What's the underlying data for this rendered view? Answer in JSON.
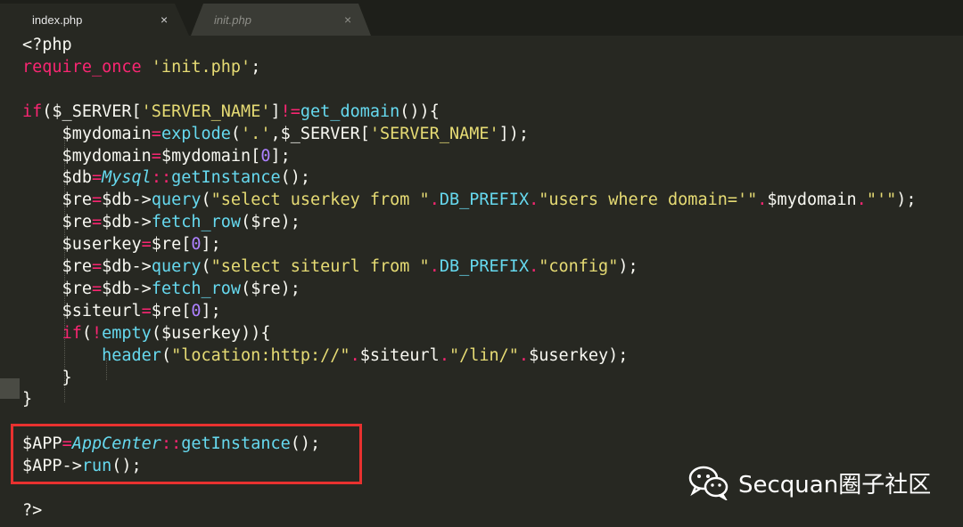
{
  "tabs": [
    {
      "label": "index.php",
      "active": true,
      "close": "×"
    },
    {
      "label": "init.php",
      "active": false,
      "close": "×"
    }
  ],
  "code": {
    "lines": [
      [
        [
          "pl",
          "<?php"
        ]
      ],
      [
        [
          "kw",
          "require_once"
        ],
        [
          "pl",
          " "
        ],
        [
          "str",
          "'init.php'"
        ],
        [
          "pl",
          ";"
        ]
      ],
      [],
      [
        [
          "kw",
          "if"
        ],
        [
          "pl",
          "($_SERVER["
        ],
        [
          "str",
          "'SERVER_NAME'"
        ],
        [
          "pl",
          "]"
        ],
        [
          "kw",
          "!="
        ],
        [
          "fn",
          "get_domain"
        ],
        [
          "pl",
          "()){"
        ]
      ],
      [
        [
          "pl",
          "    $mydomain"
        ],
        [
          "kw",
          "="
        ],
        [
          "fn",
          "explode"
        ],
        [
          "pl",
          "("
        ],
        [
          "str",
          "'.'"
        ],
        [
          "pl",
          ",$_SERVER["
        ],
        [
          "str",
          "'SERVER_NAME'"
        ],
        [
          "pl",
          "]);"
        ]
      ],
      [
        [
          "pl",
          "    $mydomain"
        ],
        [
          "kw",
          "="
        ],
        [
          "pl",
          "$mydomain["
        ],
        [
          "num",
          "0"
        ],
        [
          "pl",
          "];"
        ]
      ],
      [
        [
          "pl",
          "    $db"
        ],
        [
          "kw",
          "="
        ],
        [
          "cls",
          "Mysql"
        ],
        [
          "kw",
          "::"
        ],
        [
          "fn",
          "getInstance"
        ],
        [
          "pl",
          "();"
        ]
      ],
      [
        [
          "pl",
          "    $re"
        ],
        [
          "kw",
          "="
        ],
        [
          "pl",
          "$db->"
        ],
        [
          "fn",
          "query"
        ],
        [
          "pl",
          "("
        ],
        [
          "str",
          "\"select userkey from \""
        ],
        [
          "kw",
          "."
        ],
        [
          "fn",
          "DB_PREFIX"
        ],
        [
          "kw",
          "."
        ],
        [
          "str",
          "\"users where domain='\""
        ],
        [
          "kw",
          "."
        ],
        [
          "pl",
          "$mydomain"
        ],
        [
          "kw",
          "."
        ],
        [
          "str",
          "\"'\""
        ],
        [
          "pl",
          ");"
        ]
      ],
      [
        [
          "pl",
          "    $re"
        ],
        [
          "kw",
          "="
        ],
        [
          "pl",
          "$db->"
        ],
        [
          "fn",
          "fetch_row"
        ],
        [
          "pl",
          "($re);"
        ]
      ],
      [
        [
          "pl",
          "    $userkey"
        ],
        [
          "kw",
          "="
        ],
        [
          "pl",
          "$re["
        ],
        [
          "num",
          "0"
        ],
        [
          "pl",
          "];"
        ]
      ],
      [
        [
          "pl",
          "    $re"
        ],
        [
          "kw",
          "="
        ],
        [
          "pl",
          "$db->"
        ],
        [
          "fn",
          "query"
        ],
        [
          "pl",
          "("
        ],
        [
          "str",
          "\"select siteurl from \""
        ],
        [
          "kw",
          "."
        ],
        [
          "fn",
          "DB_PREFIX"
        ],
        [
          "kw",
          "."
        ],
        [
          "str",
          "\"config\""
        ],
        [
          "pl",
          ");"
        ]
      ],
      [
        [
          "pl",
          "    $re"
        ],
        [
          "kw",
          "="
        ],
        [
          "pl",
          "$db->"
        ],
        [
          "fn",
          "fetch_row"
        ],
        [
          "pl",
          "($re);"
        ]
      ],
      [
        [
          "pl",
          "    $siteurl"
        ],
        [
          "kw",
          "="
        ],
        [
          "pl",
          "$re["
        ],
        [
          "num",
          "0"
        ],
        [
          "pl",
          "];"
        ]
      ],
      [
        [
          "pl",
          "    "
        ],
        [
          "kw",
          "if"
        ],
        [
          "pl",
          "("
        ],
        [
          "kw",
          "!"
        ],
        [
          "fn",
          "empty"
        ],
        [
          "pl",
          "($userkey)){"
        ]
      ],
      [
        [
          "pl",
          "        "
        ],
        [
          "fn",
          "header"
        ],
        [
          "pl",
          "("
        ],
        [
          "str",
          "\"location:http://\""
        ],
        [
          "kw",
          "."
        ],
        [
          "pl",
          "$siteurl"
        ],
        [
          "kw",
          "."
        ],
        [
          "str",
          "\"/lin/\""
        ],
        [
          "kw",
          "."
        ],
        [
          "pl",
          "$userkey"
        ],
        [
          "pl",
          ");"
        ]
      ],
      [
        [
          "pl",
          "    }"
        ]
      ],
      [
        [
          "pl",
          "}"
        ]
      ],
      [],
      [
        [
          "pl",
          "$APP"
        ],
        [
          "kw",
          "="
        ],
        [
          "cls",
          "AppCenter"
        ],
        [
          "kw",
          "::"
        ],
        [
          "fn",
          "getInstance"
        ],
        [
          "pl",
          "();"
        ]
      ],
      [
        [
          "pl",
          "$APP->"
        ],
        [
          "fn",
          "run"
        ],
        [
          "pl",
          "();"
        ]
      ],
      [],
      [
        [
          "pl",
          "?>"
        ]
      ]
    ]
  },
  "watermark": {
    "text": "Secquan圈子社区",
    "icon": "wechat-icon"
  },
  "colors": {
    "background": "#272822",
    "keyword": "#f92672",
    "string": "#e6db74",
    "function": "#66d9ef",
    "number": "#ae81ff",
    "highlight": "#e8312f"
  }
}
